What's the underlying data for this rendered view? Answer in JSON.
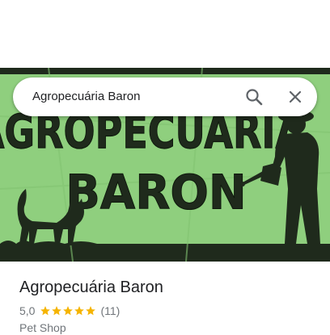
{
  "search": {
    "query": "Agropecuária Baron"
  },
  "banner": {
    "line1": "AGROPECUÁRIA",
    "line2": "BARON",
    "colors": {
      "background": "#8fcf7e",
      "ink": "#1f2a1c"
    }
  },
  "place": {
    "name": "Agropecuária Baron",
    "rating": "5,0",
    "stars": 5,
    "reviews": "(11)",
    "category": "Pet Shop"
  },
  "icons": {
    "search": "search-icon",
    "close": "close-icon",
    "star": "star-icon"
  },
  "colors": {
    "star": "#f5b400",
    "text_primary": "#202124",
    "text_secondary": "#70757a"
  }
}
